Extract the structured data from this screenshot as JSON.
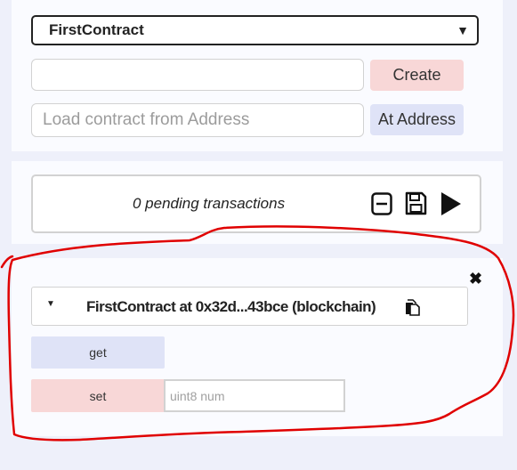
{
  "contract_select": {
    "selected": "FirstContract",
    "arrow": "▼"
  },
  "deploy": {
    "args_value": "",
    "create_label": "Create",
    "address_placeholder": "Load contract from Address",
    "at_address_label": "At Address"
  },
  "transactions": {
    "pending_text": "0 pending transactions",
    "icons": [
      "minus-square-icon",
      "save-icon",
      "play-icon"
    ]
  },
  "instance": {
    "caret": "▼",
    "title": "FirstContract at 0x32d...43bce (blockchain)",
    "close": "✖",
    "functions": [
      {
        "label": "get"
      },
      {
        "label": "set",
        "arg_placeholder": "uint8 num"
      }
    ]
  },
  "annotation": {
    "color": "#e00000"
  },
  "colors": {
    "create_bg": "#f8d7d7",
    "call_bg": "#dfe3f7",
    "page_bg": "#eef0fa"
  }
}
